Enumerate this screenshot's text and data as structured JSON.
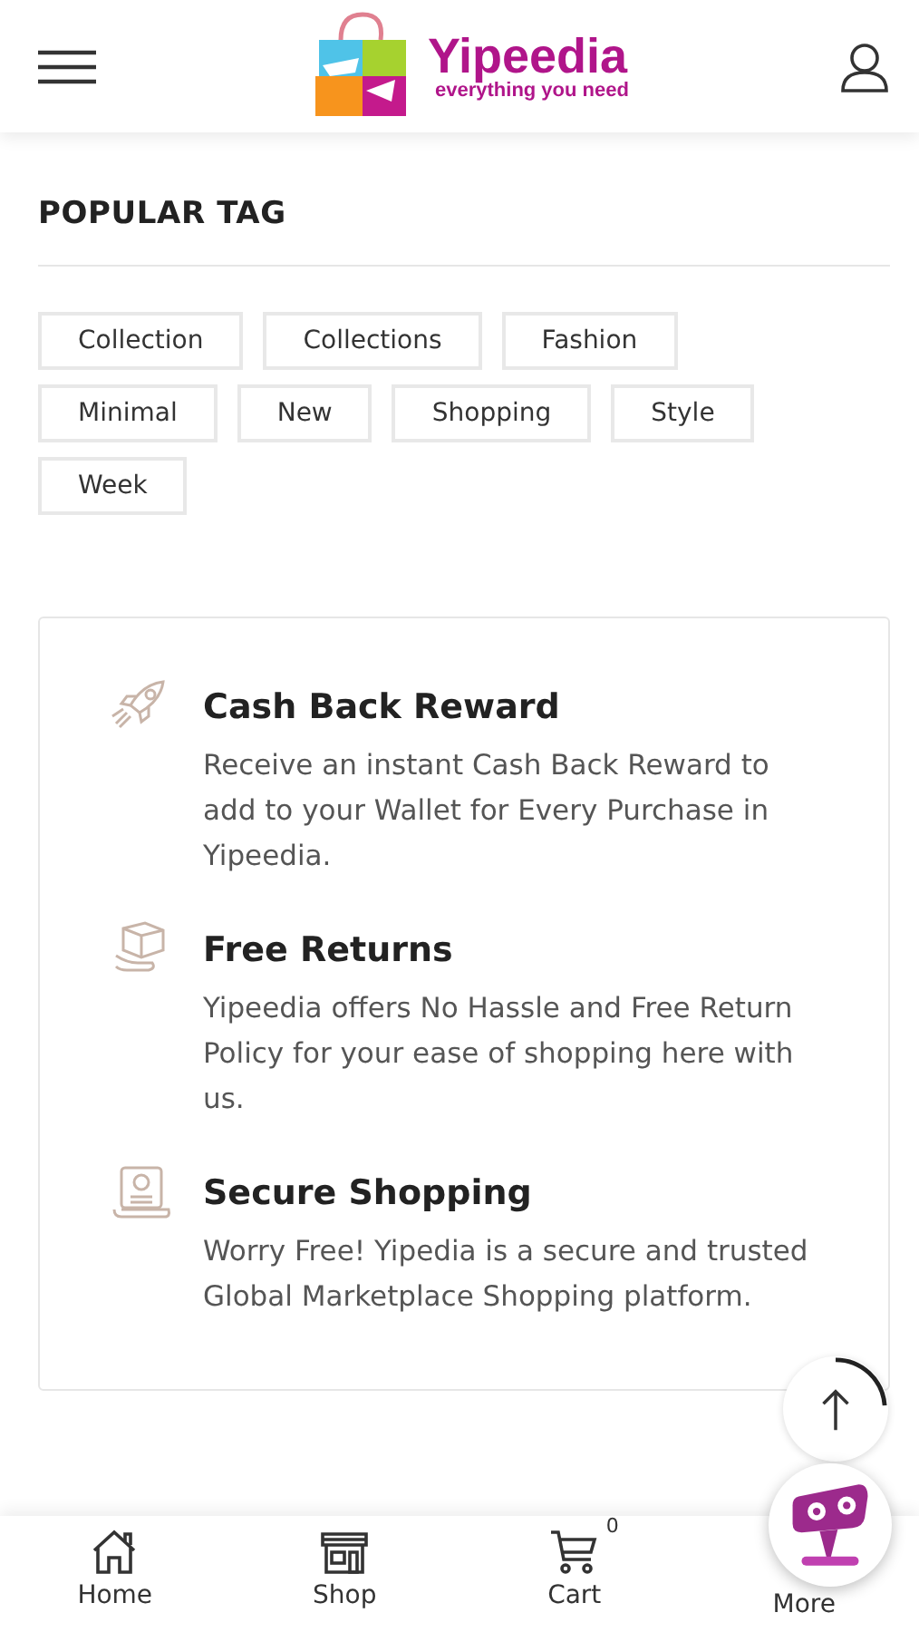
{
  "header": {
    "brand": "Yipeedia",
    "tagline": "everything you need"
  },
  "popular_tags": {
    "title": "POPULAR TAG",
    "tags": [
      "Collection",
      "Collections",
      "Fashion",
      "Minimal",
      "New",
      "Shopping",
      "Style",
      "Week"
    ]
  },
  "features": [
    {
      "kind": "rocket",
      "title": "Cash Back Reward",
      "text": "Receive an instant Cash Back Reward to add to your Wallet for Every Purchase in Yipeedia."
    },
    {
      "kind": "box",
      "title": "Free Returns",
      "text": "Yipeedia offers No Hassle and Free Return Policy for your ease of shopping here with us."
    },
    {
      "kind": "certificate",
      "title": "Secure Shopping",
      "text": "Worry Free! Yipedia is a secure and trusted Global Marketplace Shopping platform."
    }
  ],
  "bottom_nav": [
    {
      "kind": "home",
      "label": "Home"
    },
    {
      "kind": "shop",
      "label": "Shop"
    },
    {
      "kind": "cart",
      "label": "Cart",
      "badge": "0"
    },
    {
      "kind": "more",
      "label": "More"
    }
  ]
}
